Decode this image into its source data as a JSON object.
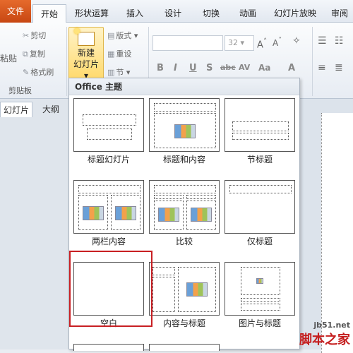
{
  "tabs": [
    {
      "label": "文件"
    },
    {
      "label": "开始"
    },
    {
      "label": "形状运算"
    },
    {
      "label": "插入"
    },
    {
      "label": "设计"
    },
    {
      "label": "切换"
    },
    {
      "label": "动画"
    },
    {
      "label": "幻灯片放映"
    },
    {
      "label": "审阅"
    }
  ],
  "ribbon": {
    "paste": "粘贴",
    "cut": "剪切",
    "copy": "复制",
    "format_painter": "格式刷",
    "clipboard_group": "剪贴板",
    "new_slide_line1": "新建",
    "new_slide_line2": "幻灯片",
    "layout": "版式",
    "reset": "重设",
    "section": "节",
    "font_size": "32",
    "format_buttons": [
      "B",
      "I",
      "U",
      "S",
      "abc",
      "AV",
      "Aa",
      "A"
    ]
  },
  "left_panel": {
    "tab_slides": "幻灯片",
    "tab_outline": "大纲"
  },
  "gallery": {
    "header": "Office 主题",
    "layouts": [
      {
        "name": "标题幻灯片"
      },
      {
        "name": "标题和内容"
      },
      {
        "name": "节标题"
      },
      {
        "name": "两栏内容"
      },
      {
        "name": "比较"
      },
      {
        "name": "仅标题"
      },
      {
        "name": "空白"
      },
      {
        "name": "内容与标题"
      },
      {
        "name": "图片与标题"
      }
    ],
    "selected": "空白"
  },
  "watermark": {
    "url": "jb51.net",
    "name": "脚本之家"
  },
  "colors": {
    "file_tab": "#d35a1f",
    "selection_border": "#c81f23",
    "new_slide_highlight": "#ffd96b"
  }
}
